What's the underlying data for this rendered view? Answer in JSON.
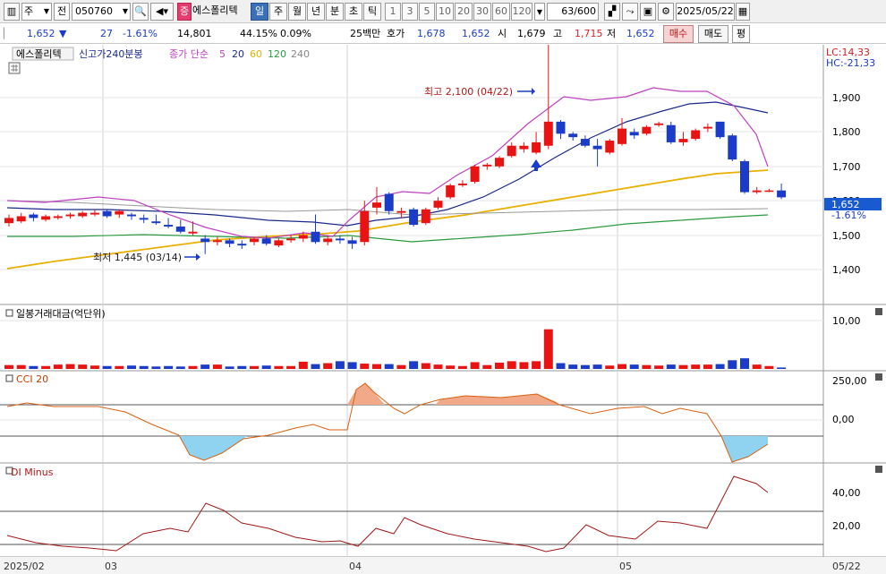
{
  "toolbar": {
    "market_label": "주",
    "period_label": "전",
    "code_value": "050760",
    "stock_badge": "증",
    "stock_name": "에스폴리텍",
    "periods": [
      "일",
      "주",
      "월",
      "년",
      "분",
      "초",
      "틱"
    ],
    "intervals": [
      "1",
      "3",
      "5",
      "10",
      "20",
      "30",
      "60",
      "120"
    ],
    "count_value": "63",
    "count_total": "/600",
    "date_value": "2025/05/22"
  },
  "info": {
    "price": "1,652",
    "change_arrow": "▼",
    "change": "27",
    "change_pct": "-1.61%",
    "volume": "14,801",
    "ratio": "44.15%",
    "ratio2": "0.09%",
    "unit_label": "25백만",
    "quote_label": "호가",
    "ask": "1,678",
    "bid": "1,652",
    "open_label": "시",
    "open": "1,679",
    "high_label": "고",
    "high": "1,715",
    "low_label": "저",
    "low": "1,652",
    "buy_button": "매수",
    "sell_button": "매도",
    "eval_button": "평"
  },
  "legend": {
    "stock_name": "에스폴리텍",
    "new_high": "신고가240분봉",
    "ma_label": "종가 단순",
    "ma5": "5",
    "ma20": "20",
    "ma60": "60",
    "ma120": "120",
    "ma240": "240",
    "lc": "LC:14,33",
    "hc": "HC:-21,33",
    "colors": {
      "ma5": "#c040c0",
      "ma20": "#1a2a8c",
      "ma60": "#e8b000",
      "ma120": "#2a9a40",
      "ma240": "#888888"
    }
  },
  "price_panel": {
    "y_ticks": [
      "1,900",
      "1,800",
      "1,700",
      "1,600",
      "1,500",
      "1,400"
    ],
    "current_price": "1,652",
    "current_pct": "-1.61%",
    "max_annotation": "최고 2,100 (04/22)",
    "min_annotation": "최저 1,445 (03/14)"
  },
  "volume_panel": {
    "title": "일봉거래대금(억단위)",
    "y_tick": "10,00"
  },
  "cci_panel": {
    "title": "CCI 20",
    "y_ticks": [
      "250,00",
      "0,00"
    ]
  },
  "di_panel": {
    "title": "DI Minus",
    "y_ticks": [
      "40,00",
      "20,00"
    ]
  },
  "x_axis": {
    "labels": [
      "2025/02",
      "03",
      "04",
      "05",
      "05/22"
    ]
  }
}
